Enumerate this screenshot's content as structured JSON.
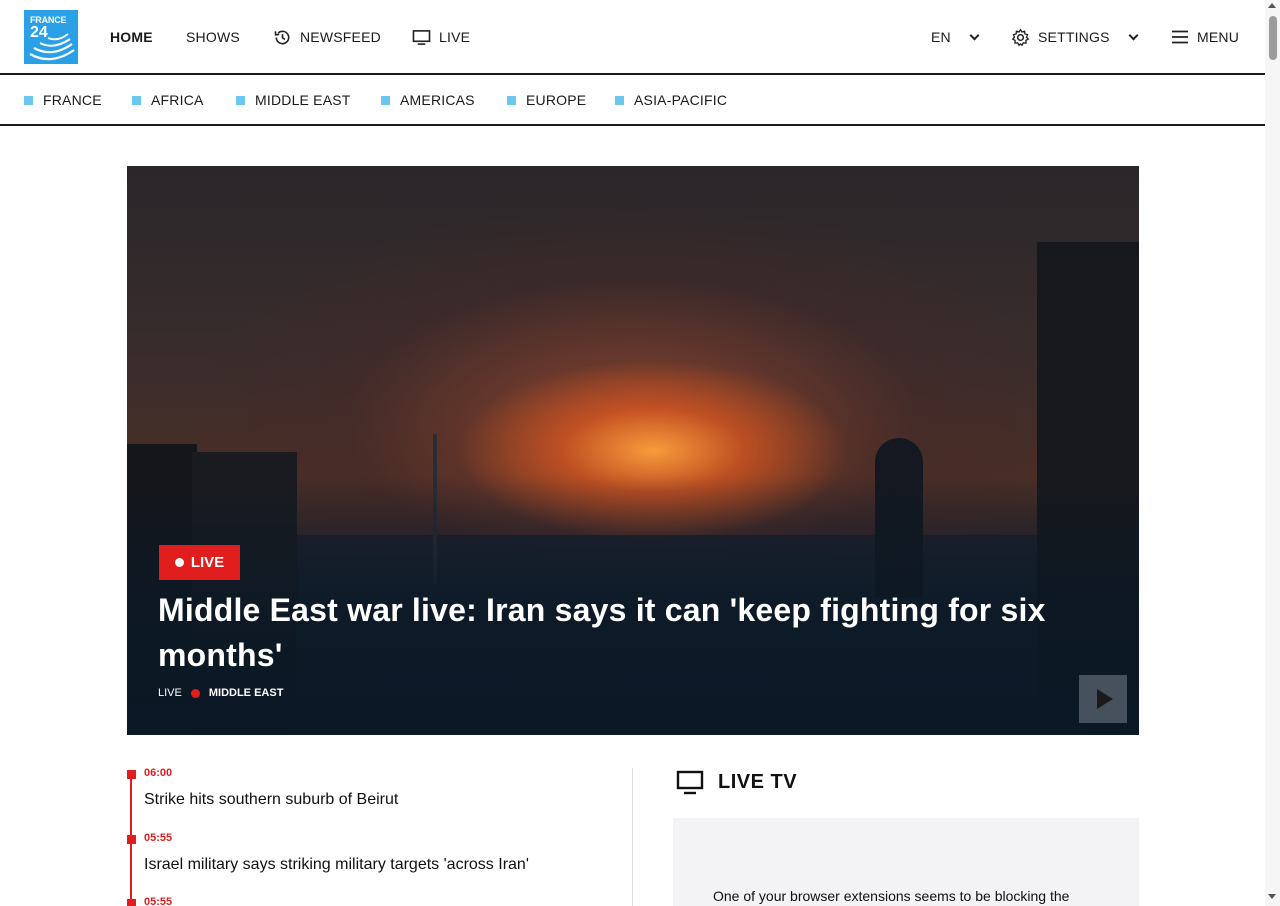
{
  "header": {
    "logo": {
      "line1": "FRANCE",
      "line2": "24"
    },
    "nav": [
      {
        "label": "HOME",
        "icon": ""
      },
      {
        "label": "SHOWS",
        "icon": ""
      },
      {
        "label": "NEWSFEED",
        "icon": "history-icon"
      },
      {
        "label": "LIVE",
        "icon": "tv-icon"
      }
    ],
    "language": "EN",
    "settings_label": "SETTINGS",
    "menu_label": "MENU"
  },
  "regions": [
    "FRANCE",
    "AFRICA",
    "MIDDLE EAST",
    "AMERICAS",
    "EUROPE",
    "ASIA-PACIFIC"
  ],
  "hero": {
    "badge": "LIVE",
    "title": "Middle East war live: Iran says it can 'keep fighting for six months'",
    "meta_live": "LIVE",
    "meta_category": "MIDDLE EAST"
  },
  "timeline": [
    {
      "time": "06:00",
      "text": "Strike hits southern suburb of Beirut"
    },
    {
      "time": "05:55",
      "text": "Israel military says striking military targets 'across Iran'"
    },
    {
      "time": "05:55",
      "text": ""
    }
  ],
  "livetv": {
    "title": "LIVE TV",
    "message": "One of your browser extensions seems to be blocking the"
  },
  "colors": {
    "accent_red": "#e11d1d",
    "brand_blue": "#2aa0e6",
    "region_square": "#6cc7ef"
  }
}
